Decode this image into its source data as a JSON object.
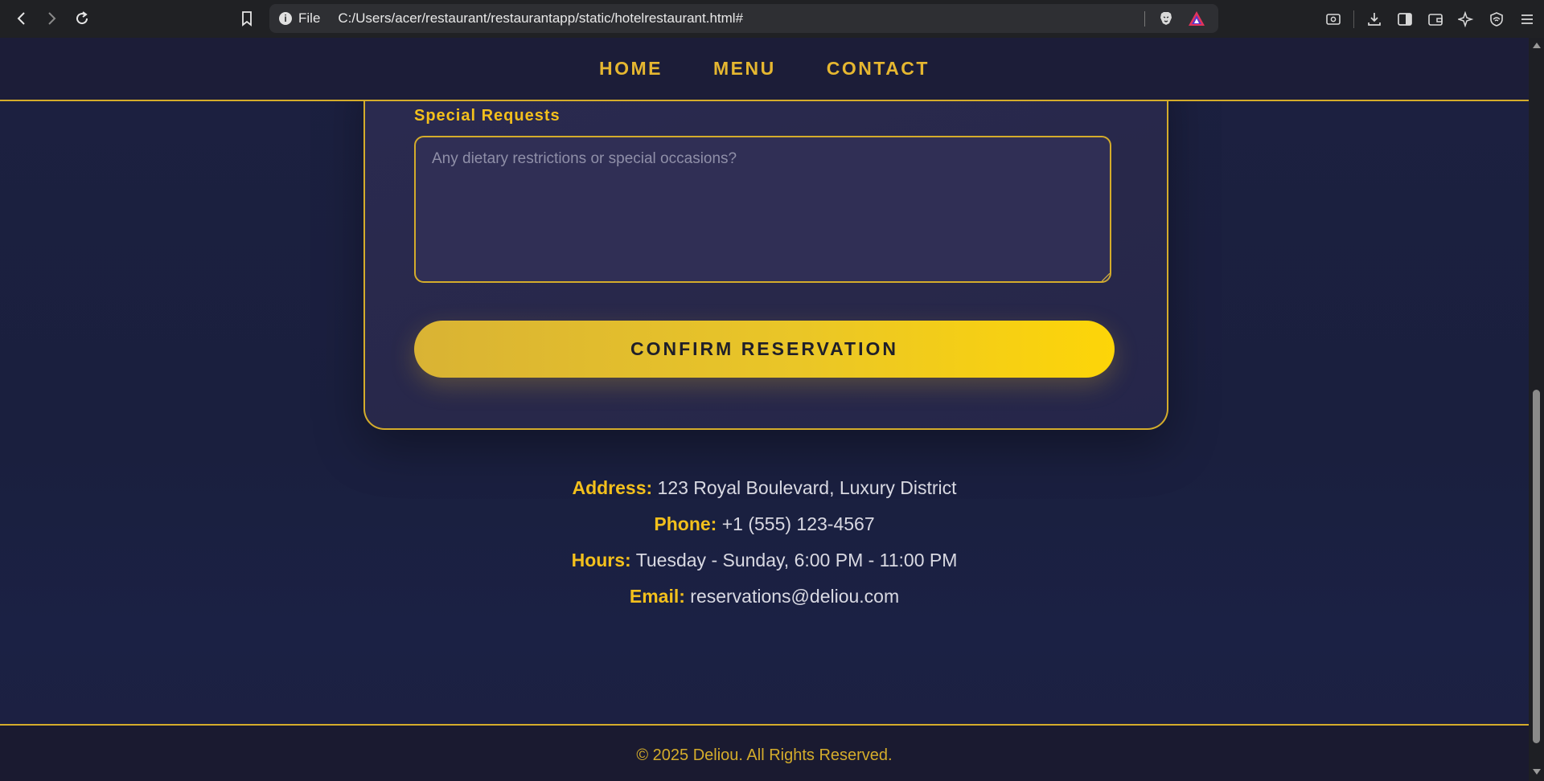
{
  "browser": {
    "url_scheme_label": "File",
    "url": "C:/Users/acer/restaurant/restaurantapp/static/hotelrestaurant.html#"
  },
  "nav": {
    "items": [
      "HOME",
      "MENU",
      "CONTACT"
    ]
  },
  "reservation": {
    "special_requests_label": "Special Requests",
    "special_requests_placeholder": "Any dietary restrictions or special occasions?",
    "confirm_label": "CONFIRM RESERVATION"
  },
  "contact": {
    "address_key": "Address:",
    "address_value": "123 Royal Boulevard, Luxury District",
    "phone_key": "Phone:",
    "phone_value": "+1 (555) 123-4567",
    "hours_key": "Hours:",
    "hours_value": "Tuesday - Sunday, 6:00 PM - 11:00 PM",
    "email_key": "Email:",
    "email_value": "reservations@deliou.com"
  },
  "footer": {
    "copyright": "© 2025 Deliou. All Rights Reserved."
  },
  "colors": {
    "accent_gold": "#d4ac2b",
    "label_yellow": "#f3c01c",
    "background_navy": "#1b1f3a"
  }
}
